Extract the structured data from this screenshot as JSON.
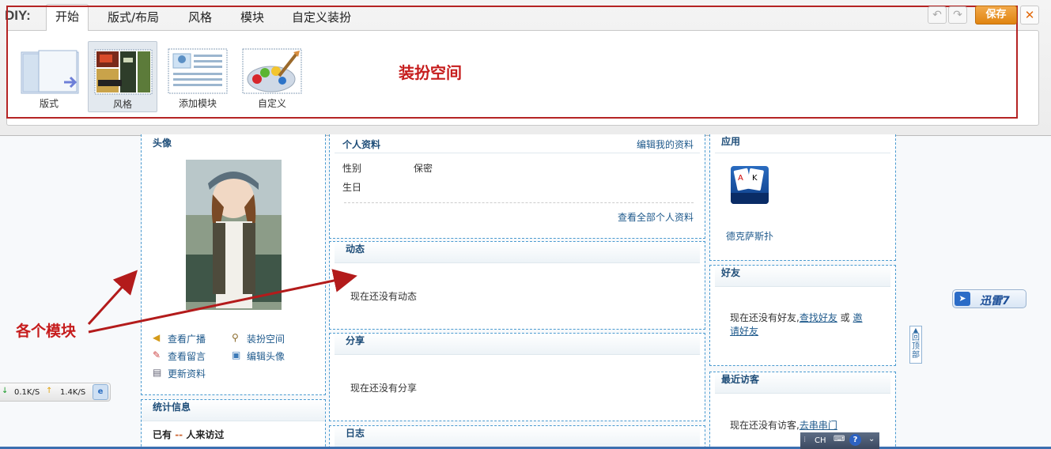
{
  "diy": {
    "label": "DIY:",
    "tabs": [
      "开始",
      "版式/布局",
      "风格",
      "模块",
      "自定义装扮"
    ],
    "tools": [
      "版式",
      "风格",
      "添加模块",
      "自定义"
    ],
    "save_label": "保存",
    "close_label": "✕",
    "undo_label": "↶",
    "redo_label": "↷"
  },
  "annotations": {
    "decorate_space": "装扮空间",
    "modules": "各个模块"
  },
  "avatar_module": {
    "title": "头像",
    "links": [
      "查看广播",
      "装扮空间",
      "查看留言",
      "编辑头像",
      "更新资料"
    ]
  },
  "stats_module": {
    "title": "统计信息",
    "visit_prefix": "已有",
    "visit_count": "--",
    "visit_suffix": "人来访过"
  },
  "profile_module": {
    "title": "个人资料",
    "edit_link": "编辑我的资料",
    "gender_label": "性别",
    "gender_value": "保密",
    "birthday_label": "生日",
    "view_all": "查看全部个人资料"
  },
  "feed_module": {
    "title": "动态",
    "empty": "现在还没有动态"
  },
  "share_module": {
    "title": "分享",
    "empty": "现在还没有分享"
  },
  "blog_module": {
    "title": "日志"
  },
  "apps_module": {
    "title": "应用",
    "app_name": "德克萨斯扑"
  },
  "friends_module": {
    "title": "好友",
    "empty_prefix": "现在还没有好友,",
    "find_link": "查找好友",
    "or_text": "或",
    "invite_link_1": "邀",
    "invite_link_2": "请好友"
  },
  "visitors_module": {
    "title": "最近访客",
    "empty_prefix": "现在还没有访客,",
    "visit_link": "去串串门"
  },
  "widgets": {
    "speed_down": "0.1K/S",
    "speed_up": "1.4K/S",
    "thunder": "迅雷7",
    "back_top": [
      "回",
      "顶",
      "部"
    ],
    "ime": "CH"
  },
  "colors": {
    "accent_red": "#c61d1d",
    "save_orange": "#e08410",
    "link_blue": "#1f5a8c",
    "module_border": "#4a9ad0"
  }
}
